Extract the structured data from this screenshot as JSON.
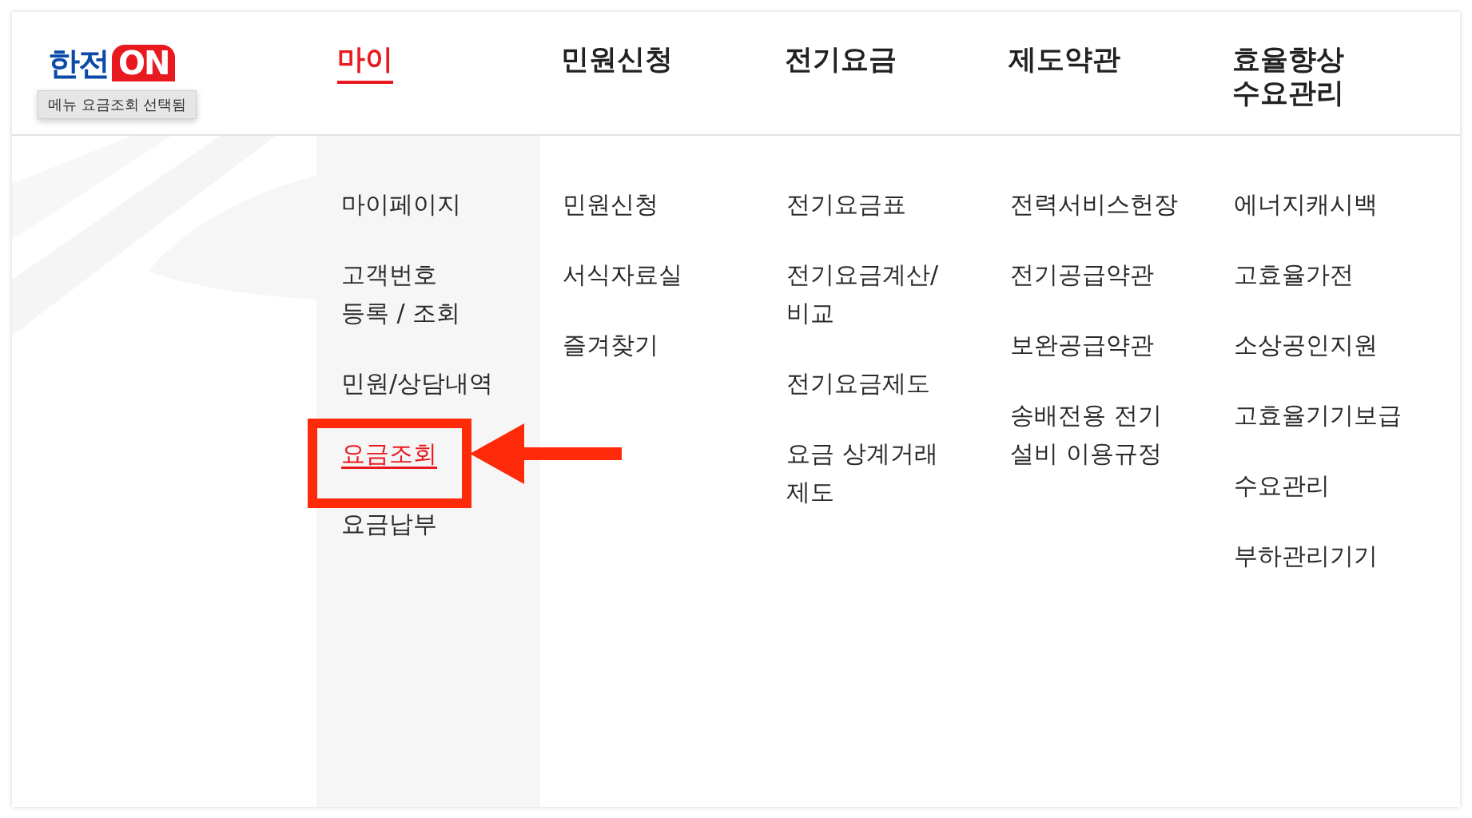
{
  "logo": {
    "main": "한전",
    "accent": "ON"
  },
  "tooltip": "메뉴 요금조회 선택됨",
  "nav": [
    {
      "label": "마이",
      "selected": true
    },
    {
      "label": "민원신청",
      "selected": false
    },
    {
      "label": "전기요금",
      "selected": false
    },
    {
      "label": "제도약관",
      "selected": false
    },
    {
      "label": "효율향상\n수요관리",
      "selected": false
    }
  ],
  "columns": [
    {
      "shaded": true,
      "items": [
        {
          "label": "마이페이지",
          "selected": false
        },
        {
          "label": "고객번호\n등록 / 조회",
          "selected": false
        },
        {
          "label": "민원/상담내역",
          "selected": false
        },
        {
          "label": "요금조회",
          "selected": true
        },
        {
          "label": "요금납부",
          "selected": false
        }
      ]
    },
    {
      "shaded": false,
      "items": [
        {
          "label": "민원신청",
          "selected": false
        },
        {
          "label": "서식자료실",
          "selected": false
        },
        {
          "label": "즐겨찾기",
          "selected": false
        }
      ]
    },
    {
      "shaded": false,
      "items": [
        {
          "label": "전기요금표",
          "selected": false
        },
        {
          "label": "전기요금계산/\n비교",
          "selected": false
        },
        {
          "label": "전기요금제도",
          "selected": false
        },
        {
          "label": "요금 상계거래\n제도",
          "selected": false
        }
      ]
    },
    {
      "shaded": false,
      "items": [
        {
          "label": "전력서비스헌장",
          "selected": false
        },
        {
          "label": "전기공급약관",
          "selected": false
        },
        {
          "label": "보완공급약관",
          "selected": false
        },
        {
          "label": "송배전용 전기\n설비 이용규정",
          "selected": false
        }
      ]
    },
    {
      "shaded": false,
      "items": [
        {
          "label": "에너지캐시백",
          "selected": false
        },
        {
          "label": "고효율가전",
          "selected": false
        },
        {
          "label": "소상공인지원",
          "selected": false
        },
        {
          "label": "고효율기기보급",
          "selected": false
        },
        {
          "label": "수요관리",
          "selected": false
        },
        {
          "label": "부하관리기기",
          "selected": false
        }
      ]
    }
  ]
}
